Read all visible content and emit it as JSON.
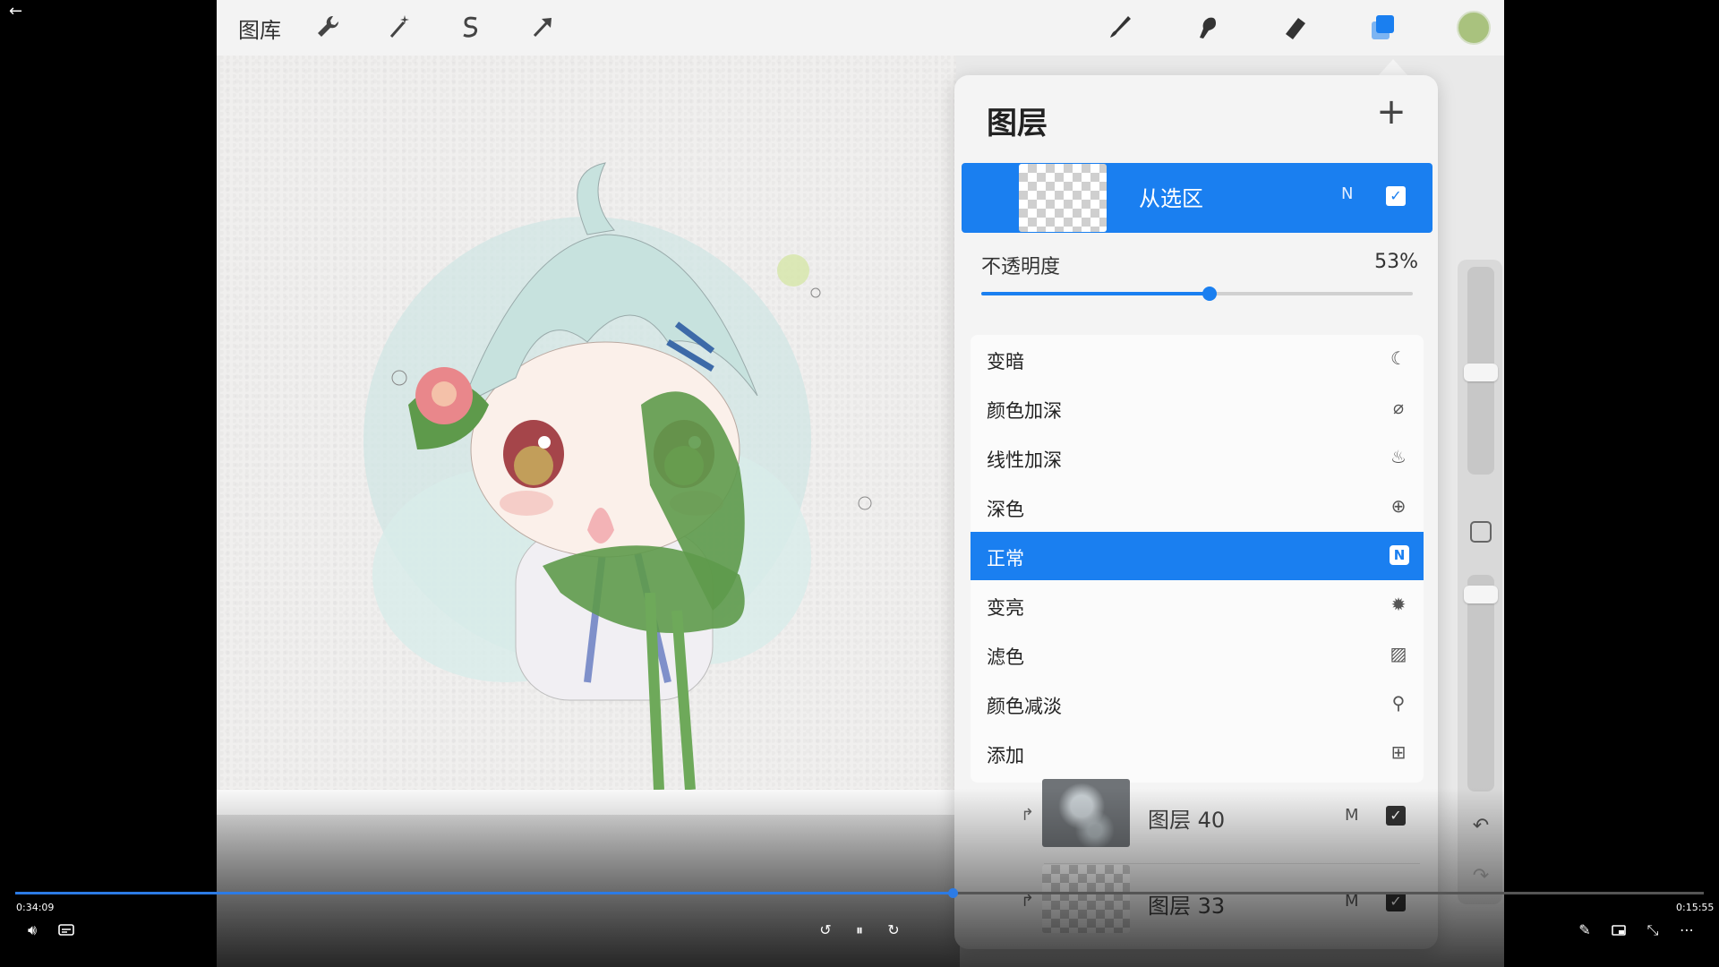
{
  "player": {
    "time_elapsed": "0:34:09",
    "time_total": "0:15:55",
    "progress_fraction": 0.555
  },
  "toolbar": {
    "gallery_label": "图库",
    "tools": [
      "wrench-icon",
      "magic-wand-icon",
      "selection-s-icon",
      "transform-arrow-icon"
    ],
    "right_tools": [
      "brush-icon",
      "smudge-icon",
      "eraser-icon",
      "layers-icon"
    ],
    "color_swatch": "#a9c27e"
  },
  "layers": {
    "title": "图层",
    "active": {
      "name": "从选区",
      "mode": "N"
    },
    "opacity": {
      "label": "不透明度",
      "value_text": "53%",
      "value": 0.53
    },
    "blend_modes": [
      {
        "label": "变暗",
        "icon": "moon-icon"
      },
      {
        "label": "颜色加深",
        "icon": "drop-slash-icon"
      },
      {
        "label": "线性加深",
        "icon": "flame-icon"
      },
      {
        "label": "深色",
        "icon": "plus-circle-icon"
      },
      {
        "label": "正常",
        "icon": "n-badge-icon",
        "badge": "N",
        "selected": true
      },
      {
        "label": "变亮",
        "icon": "sun-icon"
      },
      {
        "label": "滤色",
        "icon": "hatch-icon"
      },
      {
        "label": "颜色减淡",
        "icon": "pin-icon"
      },
      {
        "label": "添加",
        "icon": "plus-square-icon"
      }
    ],
    "rows": [
      {
        "name": "图层 40",
        "mode": "M"
      },
      {
        "name": "图层 33",
        "mode": "M"
      }
    ]
  },
  "colors": {
    "accent": "#1a7ff0",
    "progress": "#2c7be5"
  }
}
